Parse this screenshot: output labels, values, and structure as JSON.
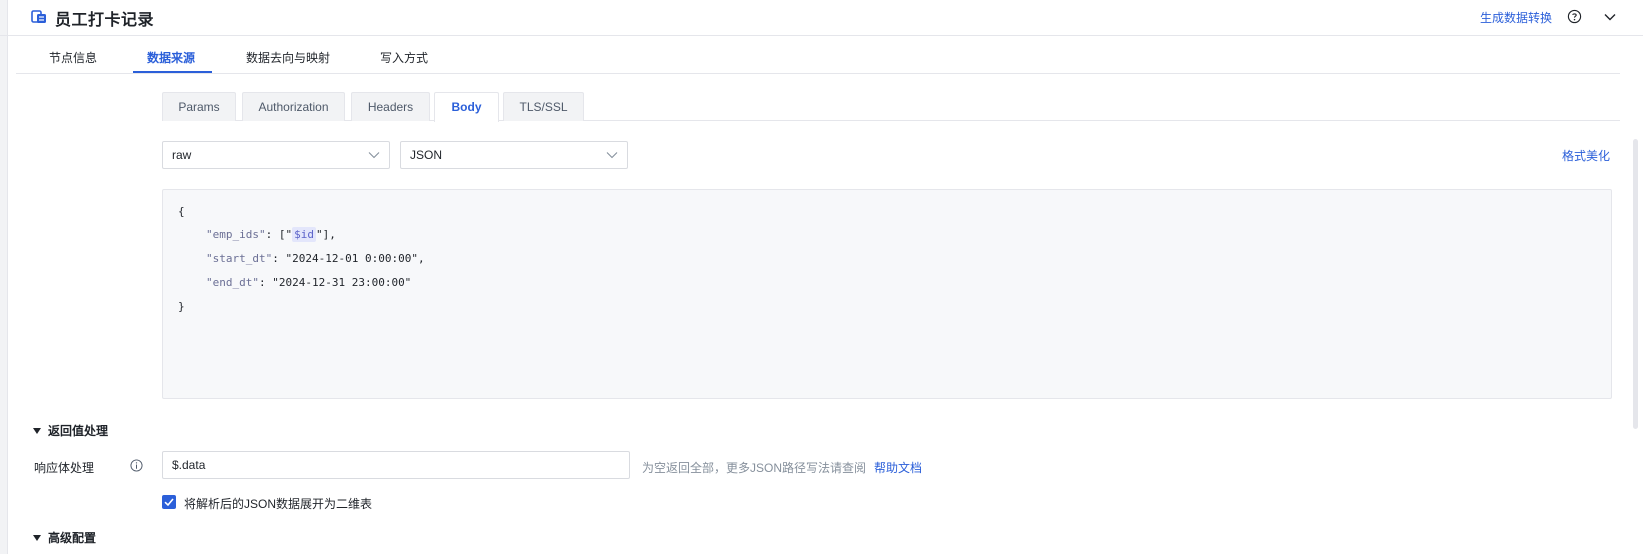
{
  "header": {
    "title": "员工打卡记录",
    "app_icon": "db-connector-icon",
    "generate_link": "生成数据转换",
    "help_icon": "help-circle-icon",
    "collapse_icon": "chevron-down-icon"
  },
  "tabs": [
    {
      "label": "节点信息",
      "active": false
    },
    {
      "label": "数据来源",
      "active": true
    },
    {
      "label": "数据去向与映射",
      "active": false
    },
    {
      "label": "写入方式",
      "active": false
    }
  ],
  "subtabs": [
    {
      "label": "Params",
      "active": false
    },
    {
      "label": "Authorization",
      "active": false
    },
    {
      "label": "Headers",
      "active": false
    },
    {
      "label": "Body",
      "active": true
    },
    {
      "label": "TLS/SSL",
      "active": false
    }
  ],
  "body": {
    "mode_select": "raw",
    "format_select": "JSON",
    "beautify_label": "格式美化",
    "code": {
      "open": "{",
      "close": "}",
      "emp_ids_key": "\"emp_ids\"",
      "emp_ids_var": "$id",
      "start_key": "\"start_dt\"",
      "start_val": "\"2024-12-01 0:00:00\"",
      "end_key": "\"end_dt\"",
      "end_val": "\"2024-12-31 23:00:00\""
    }
  },
  "return_section": {
    "title": "返回值处理",
    "field_label": "响应体处理",
    "input_value": "$.data",
    "hint": "为空返回全部，更多JSON路径写法请查阅",
    "help_doc": "帮助文档",
    "checkbox_checked": true,
    "checkbox_label": "将解析后的JSON数据展开为二维表"
  },
  "advanced_section": {
    "title": "高级配置"
  },
  "colors": {
    "accent": "#2b5fd9",
    "editor_bg": "#f7f8fa",
    "variable_bg": "#e3e6fb"
  }
}
